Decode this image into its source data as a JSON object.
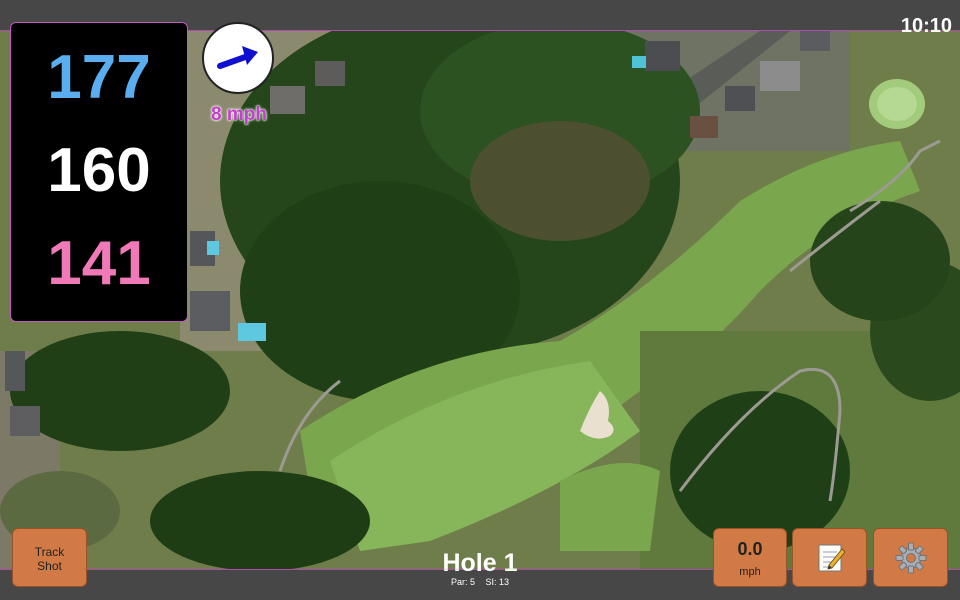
{
  "status": {
    "time": "10:10"
  },
  "distances": {
    "back": "177",
    "center": "160",
    "front": "141",
    "colors": {
      "back": "#5aaef0",
      "center": "#ffffff",
      "front": "#f07ab8"
    }
  },
  "wind": {
    "speed_label": "8 mph",
    "direction_icon": "wind-arrow-icon",
    "arrow_color": "#1010d0"
  },
  "hole": {
    "title": "Hole 1",
    "par": "Par: 5",
    "stroke_index": "SI: 13"
  },
  "buttons": {
    "track_shot_line1": "Track",
    "track_shot_line2": "Shot",
    "wind_value": "0.0",
    "wind_unit": "mph",
    "notes_icon": "notepad-icon",
    "settings_icon": "gear-icon",
    "accent_color": "#d27a45"
  },
  "map": {
    "type": "satellite-course-view"
  }
}
